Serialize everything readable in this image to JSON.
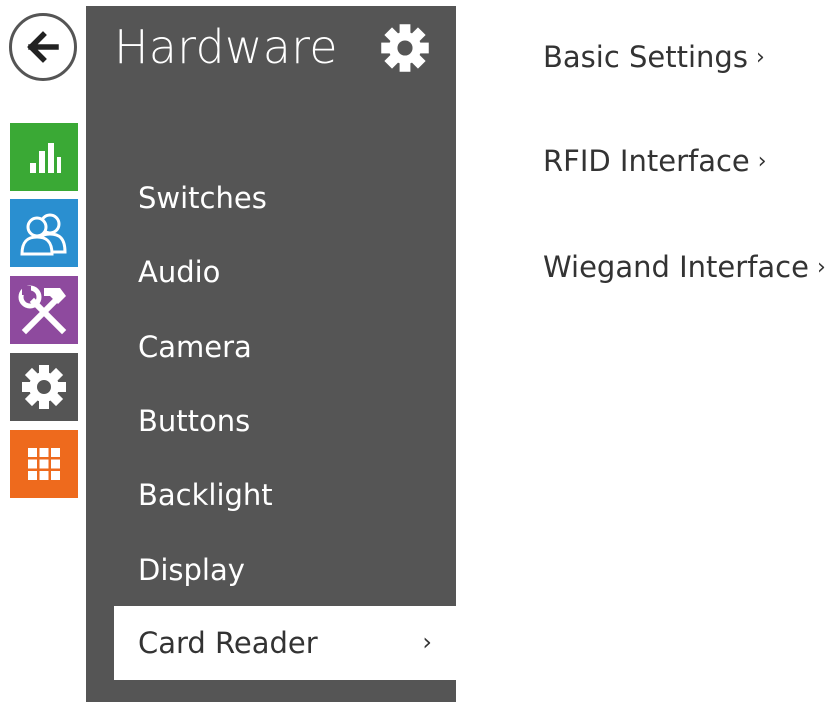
{
  "colors": {
    "sidebar_bg": "#555555",
    "status_tile": "#3aa935",
    "users_tile": "#2a8fd0",
    "services_tile": "#8e4a9e",
    "hardware_tile": "#555555",
    "system_tile": "#ee6a1d"
  },
  "nav_rail": {
    "back": {
      "icon": "arrow-left-icon"
    },
    "tiles": [
      {
        "name": "status",
        "icon": "bar-chart-icon"
      },
      {
        "name": "users",
        "icon": "users-icon"
      },
      {
        "name": "services",
        "icon": "hammer-wrench-icon"
      },
      {
        "name": "hardware",
        "icon": "gear-icon"
      },
      {
        "name": "system",
        "icon": "grid-icon"
      }
    ]
  },
  "sidebar": {
    "title": "Hardware",
    "title_icon": "gear-icon",
    "items": [
      {
        "label": "Switches"
      },
      {
        "label": "Audio"
      },
      {
        "label": "Camera"
      },
      {
        "label": "Buttons"
      },
      {
        "label": "Backlight"
      },
      {
        "label": "Display"
      },
      {
        "label": "Card Reader",
        "active": true,
        "chevron": "›"
      }
    ]
  },
  "content": {
    "links": [
      {
        "label": "Basic Settings",
        "chevron": "›"
      },
      {
        "label": "RFID Interface",
        "chevron": "›"
      },
      {
        "label": "Wiegand Interface",
        "chevron": "›"
      }
    ]
  }
}
